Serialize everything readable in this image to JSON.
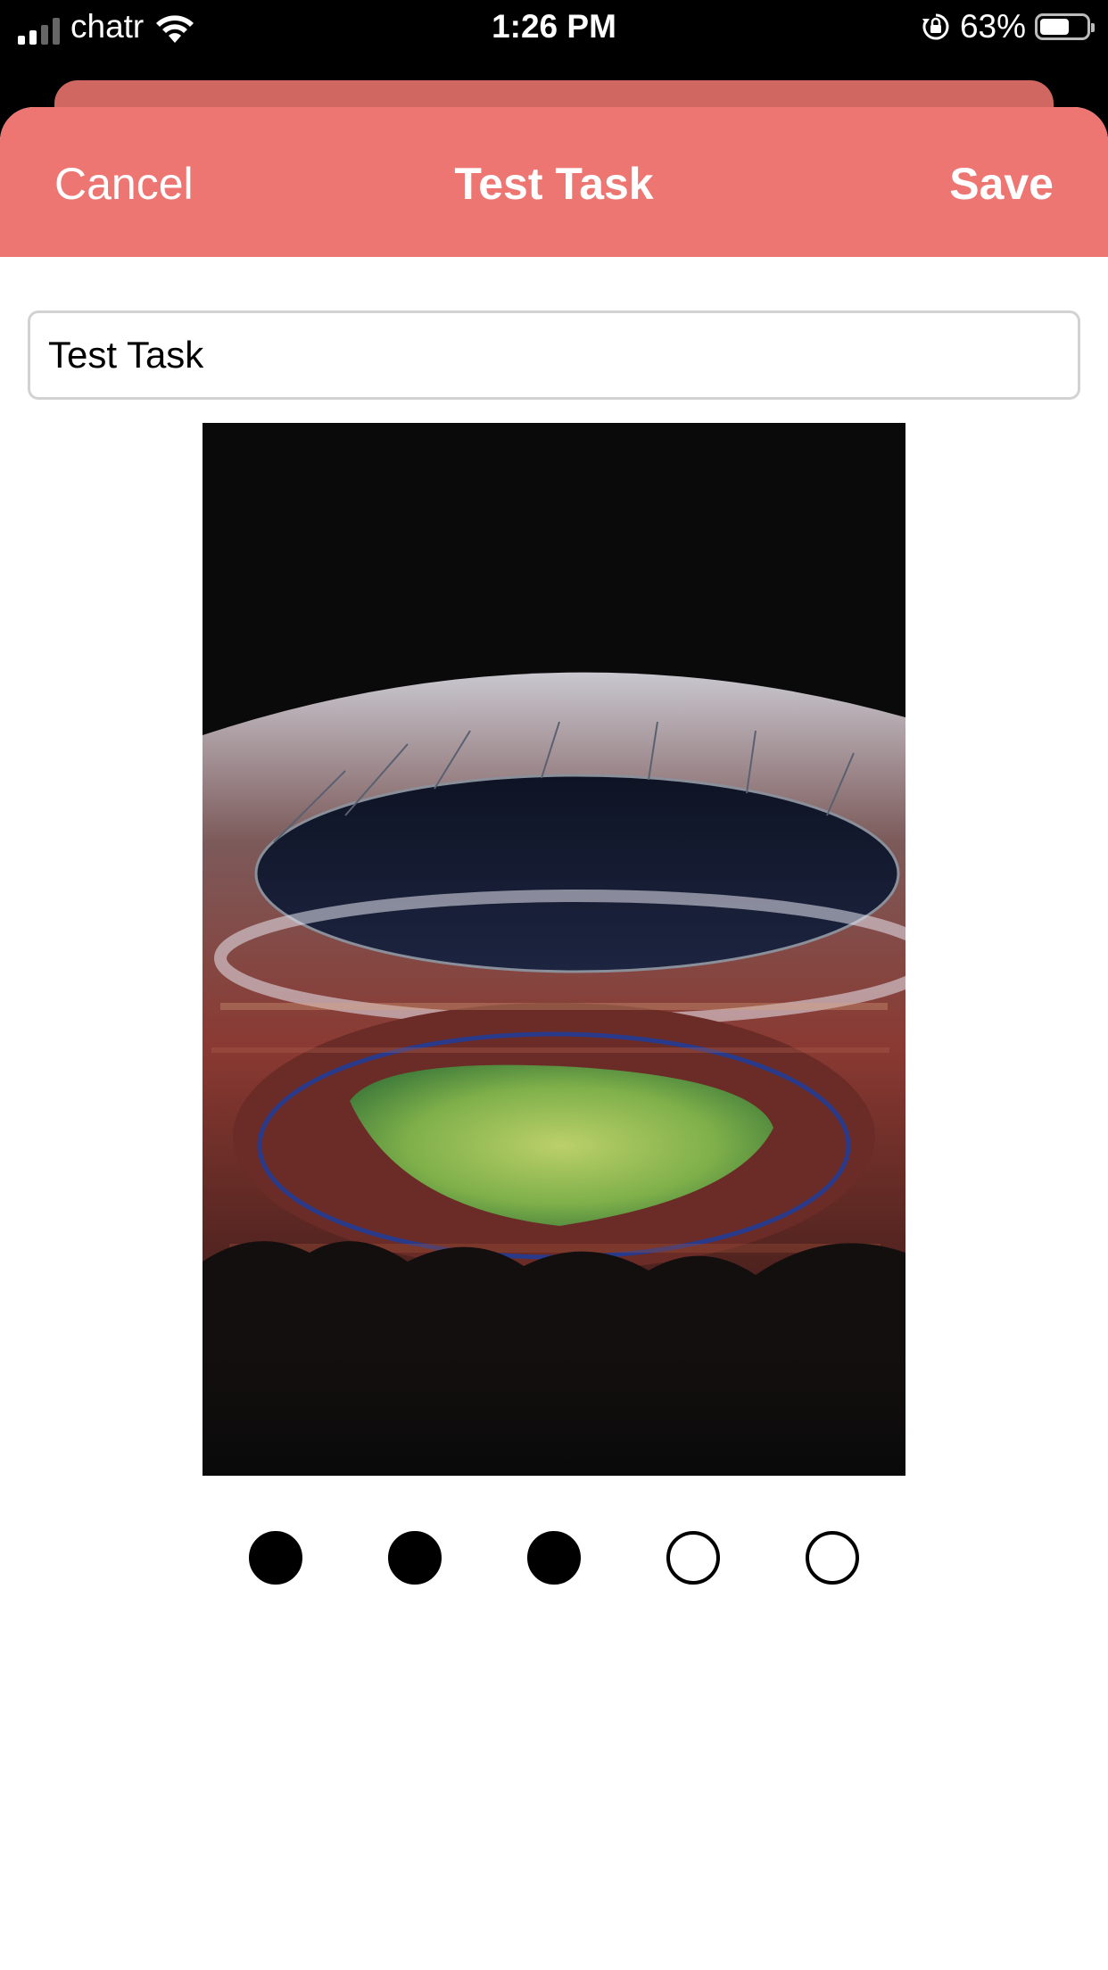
{
  "status_bar": {
    "carrier": "chatr",
    "time": "1:26 PM",
    "battery_percent": "63%",
    "battery_level": 0.63,
    "signal_bars_active": 2,
    "icons": [
      "signal-icon",
      "wifi-icon",
      "rotation-lock-icon",
      "battery-icon"
    ]
  },
  "nav": {
    "cancel_label": "Cancel",
    "title": "Test Task",
    "save_label": "Save",
    "color": "#ed7672"
  },
  "task": {
    "name_value": "Test Task"
  },
  "image": {
    "subject": "illustrated football stadium at night"
  },
  "rating": {
    "value": 3,
    "max": 5
  }
}
